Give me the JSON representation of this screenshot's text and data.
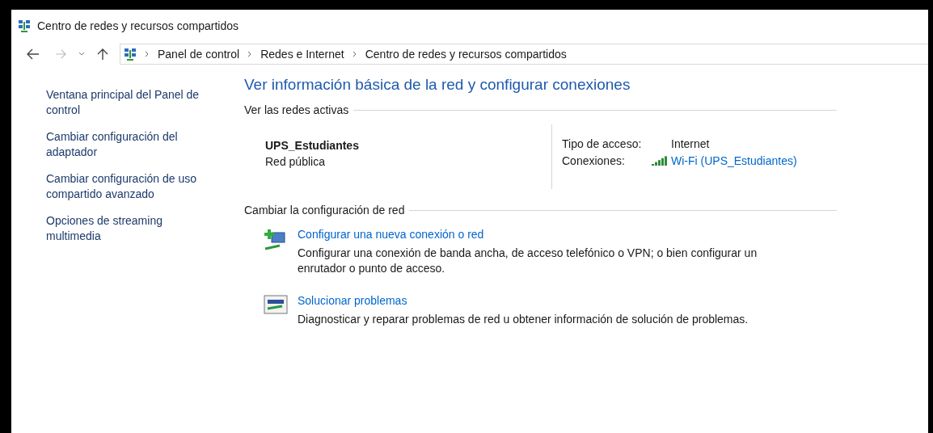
{
  "window": {
    "title": "Centro de redes y recursos compartidos"
  },
  "address_bar": {
    "breadcrumbs": [
      "Panel de control",
      "Redes e Internet",
      "Centro de redes y recursos compartidos"
    ]
  },
  "sidebar": {
    "links": [
      "Ventana principal del Panel de control",
      "Cambiar configuración del adaptador",
      "Cambiar configuración de uso compartido avanzado",
      "Opciones de streaming multimedia"
    ]
  },
  "main": {
    "heading": "Ver información básica de la red y configurar conexiones",
    "active_networks": {
      "section_title": "Ver las redes activas",
      "network": {
        "name": "UPS_Estudiantes",
        "category": "Red pública"
      },
      "details": [
        {
          "label": "Tipo de acceso:",
          "value": "Internet",
          "kind": "text"
        },
        {
          "label": "Conexiones:",
          "value": "Wi-Fi (UPS_Estudiantes)",
          "kind": "link"
        }
      ]
    },
    "change_settings": {
      "section_title": "Cambiar la configuración de red",
      "tasks": [
        {
          "kind": "new-connection",
          "title": "Configurar una nueva conexión o red",
          "description": "Configurar una conexión de banda ancha, de acceso telefónico o VPN; o bien configurar un enrutador o punto de acceso."
        },
        {
          "kind": "troubleshoot",
          "title": "Solucionar problemas",
          "description": "Diagnosticar y reparar problemas de red u obtener información de solución de problemas."
        }
      ]
    }
  }
}
